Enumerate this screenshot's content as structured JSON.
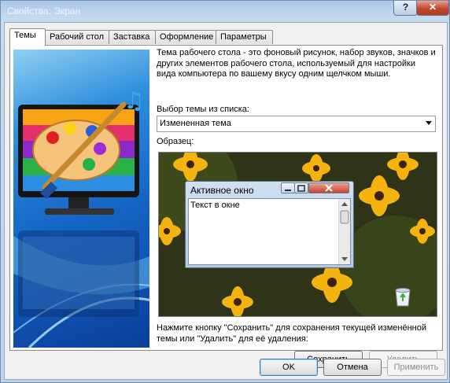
{
  "window": {
    "title": "Свойства: Экран"
  },
  "titlebar_buttons": {
    "help": "?",
    "close": "✕"
  },
  "tabs": [
    {
      "label": "Темы",
      "active": true
    },
    {
      "label": "Рабочий стол",
      "active": false
    },
    {
      "label": "Заставка",
      "active": false
    },
    {
      "label": "Оформление",
      "active": false
    },
    {
      "label": "Параметры",
      "active": false
    }
  ],
  "themes_tab": {
    "description": "Тема рабочего стола - это фоновый рисунок, набор звуков, значков и других элементов рабочего стола, используемый для настройки вида компьютера по вашему вкусу одним щелчком мыши.",
    "select_label": "Выбор темы из списка:",
    "selected_theme": "Измененная тема",
    "preview_label": "Образец:",
    "preview_window": {
      "title": "Активное окно",
      "text": "Текст в окне",
      "buttons": {
        "minimize": "minimize-icon",
        "maximize": "maximize-icon",
        "close": "close-icon"
      }
    },
    "hint": "Нажмите кнопку \"Сохранить\" для сохранения текущей изменённой темы или \"Удалить\" для её удаления:",
    "save_button": "Сохранить",
    "delete_button": "Удалить"
  },
  "footer": {
    "ok": "OK",
    "cancel": "Отмена",
    "apply": "Применить"
  },
  "icons": {
    "art": "monitor-paint-palette-icon",
    "recycle_bin": "recycle-bin-icon"
  },
  "colors": {
    "accent_blue": "#1566c6",
    "titlebar": "#a9c7e6",
    "close_red": "#c2462f"
  }
}
